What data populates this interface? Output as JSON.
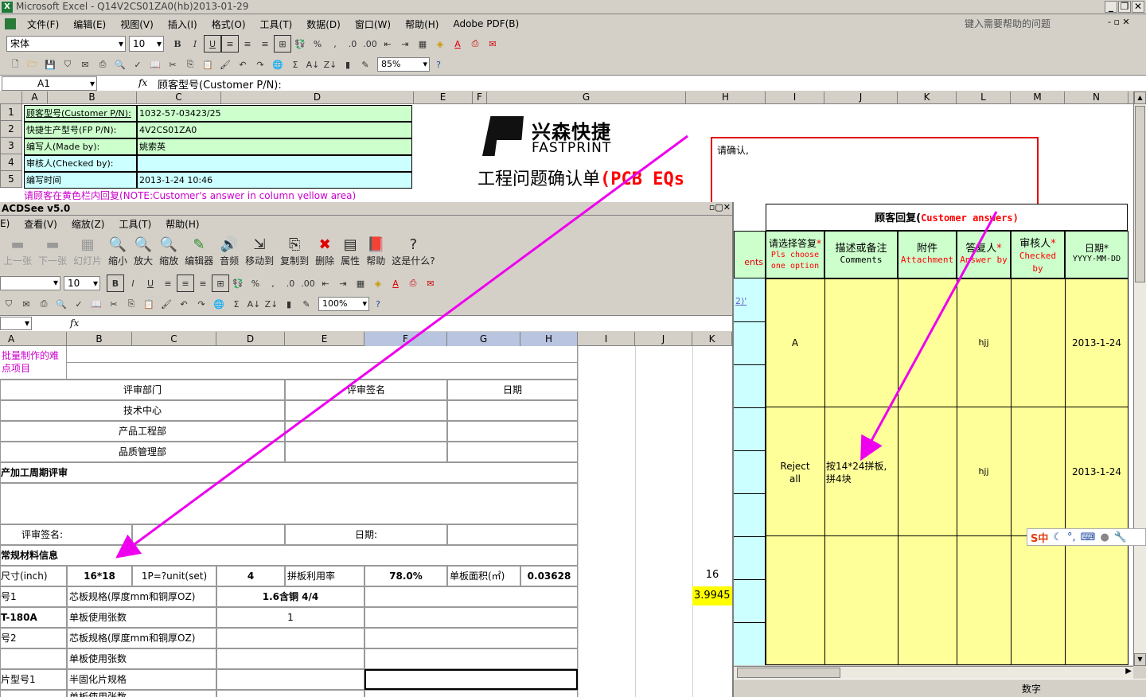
{
  "excel": {
    "title": "Microsoft Excel - Q14V2CS01ZA0(hb)2013-01-29",
    "menu": [
      "文件(F)",
      "编辑(E)",
      "视图(V)",
      "插入(I)",
      "格式(O)",
      "工具(T)",
      "数据(D)",
      "窗口(W)",
      "帮助(H)",
      "Adobe PDF(B)"
    ],
    "help_placeholder": "键入需要帮助的问题",
    "font_name": "宋体",
    "font_size": "10",
    "zoom": "85%",
    "name_box": "A1",
    "fx": "fx",
    "formula": "顾客型号(Customer P/N):",
    "col_headers": [
      "A",
      "B",
      "C",
      "D",
      "E",
      "F",
      "G",
      "H",
      "I",
      "J",
      "K",
      "L",
      "M",
      "N"
    ],
    "rows": [
      {
        "num": "1",
        "label": "顾客型号(Customer P/N):",
        "value": "1032-57-03423/25"
      },
      {
        "num": "2",
        "label": "快捷生产型号(FP P/N):",
        "value": "4V2CS01ZA0"
      },
      {
        "num": "3",
        "label": "编写人(Made by):",
        "value": "姚索英"
      },
      {
        "num": "4",
        "label": "审核人(Checked by):",
        "value": ""
      },
      {
        "num": "5",
        "label": "编写时间",
        "value": "2013-1-24 10:46"
      }
    ],
    "row6_note": "请顾客在黄色栏内回复(NOTE:Customer's answer in column yellow area)",
    "logo_cn": "兴森快捷",
    "logo_en": "FASTPRINT",
    "doc_title": "工程问题确认单",
    "doc_title_red": "(PCB EQs",
    "comment_text": "请确认,",
    "customer_answers_header": "顾客回复(",
    "customer_answers_en": "Customer answers)",
    "right_headers": [
      {
        "cn": "请选择答复",
        "en": "Pls choose one option"
      },
      {
        "cn": "描述或备注",
        "en": "Comments"
      },
      {
        "cn": "附件",
        "en": "Attachment"
      },
      {
        "cn": "答复人",
        "en": "Answer by"
      },
      {
        "cn": "审核人",
        "en": "Checked by"
      },
      {
        "cn": "日期*",
        "en": "YYYY-MM-DD"
      }
    ],
    "left_hdr_frag": "ents",
    "left_link_frag": "2)'",
    "answer_rows": [
      {
        "option": "A",
        "comments": "",
        "answer_by": "hjj",
        "date": "2013-1-24"
      },
      {
        "option": "Reject all",
        "comments": "按14*24拼板,拼4块",
        "answer_by": "hjj",
        "date": "2013-1-24"
      }
    ],
    "status": "数字",
    "ime_text": "S中",
    "asterisk": "*"
  },
  "acdsee": {
    "title": "ACDSee v5.0",
    "menu": [
      "E)",
      "查看(V)",
      "缩放(Z)",
      "工具(T)",
      "帮助(H)"
    ],
    "toolbar": [
      "上一张",
      "下一张",
      "幻灯片",
      "缩小",
      "放大",
      "缩放",
      "编辑器",
      "音频",
      "移动到",
      "复制到",
      "删除",
      "属性",
      "帮助",
      "这是什么?"
    ],
    "font_size": "10",
    "zoom": "100%",
    "fx": "fx",
    "col_headers": [
      "A",
      "B",
      "C",
      "D",
      "E",
      "F",
      "G",
      "H",
      "I",
      "J",
      "K"
    ],
    "cells": {
      "r1a": "批量制作的难",
      "r1b": "点项目",
      "dept": "评审部门",
      "sign": "评审签名",
      "date": "日期",
      "tech": "技术中心",
      "prod_eng": "产品工程部",
      "quality": "品质管理部",
      "cycle": "产加工周期评审",
      "sign2": "评审签名:",
      "date2": "日期:",
      "material": "常规材料信息",
      "size_lbl": "尺寸(inch)",
      "size_val": "16*18",
      "unit_lbl": "1P=?unit(set)",
      "unit_val": "4",
      "util_lbl": "拼板利用率",
      "util_val": "78.0%",
      "area_lbl": "单板面积(㎡)",
      "area_val": "0.03628",
      "k_val": "16",
      "k_val2": "3.9945",
      "r_号1": "号1",
      "core_spec": "芯板规格(厚度mm和铜厚OZ)",
      "core_val": "1.6含铜 4/4",
      "t180a": "T-180A",
      "usage": "单板使用张数",
      "usage_val": "1",
      "r_号2": "号2",
      "core_spec2": "芯板规格(厚度mm和铜厚OZ)",
      "usage2": "单板使用张数",
      "pp_type": "片型号1",
      "pp_spec": "半固化片规格",
      "usage3": "单板使用张数"
    }
  },
  "colors": {
    "arrow": "#ee00ee",
    "comment_border": "#e00000",
    "green_cell": "#ccffcc",
    "cyan_cell": "#ccffff",
    "yellow_cell": "#ffff99"
  }
}
